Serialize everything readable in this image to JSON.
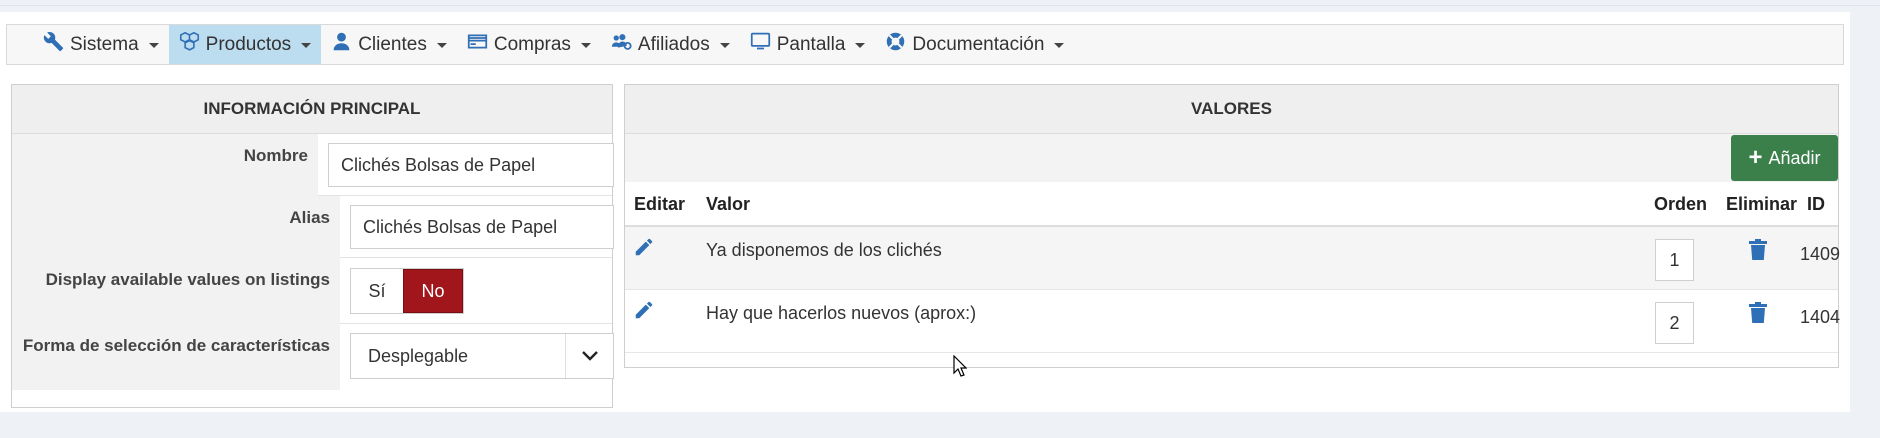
{
  "navbar": {
    "items": [
      {
        "label": "Sistema",
        "icon": "wrench-icon",
        "active": false
      },
      {
        "label": "Productos",
        "icon": "cubes-icon",
        "active": true
      },
      {
        "label": "Clientes",
        "icon": "user-icon",
        "active": false
      },
      {
        "label": "Compras",
        "icon": "credit-card-icon",
        "active": false
      },
      {
        "label": "Afiliados",
        "icon": "users-cog-icon",
        "active": false
      },
      {
        "label": "Pantalla",
        "icon": "monitor-icon",
        "active": false
      },
      {
        "label": "Documentación",
        "icon": "life-ring-icon",
        "active": false
      }
    ]
  },
  "info": {
    "heading": "INFORMACIÓN PRINCIPAL",
    "nombre_label": "Nombre",
    "nombre_value": "Clichés Bolsas de Papel",
    "alias_label": "Alias",
    "alias_value": "Clichés Bolsas de Papel",
    "display_label": "Display available values on listings",
    "toggle_si": "Sí",
    "toggle_no": "No",
    "toggle_selected": "No",
    "forma_label": "Forma de selección de características",
    "forma_value": "Desplegable"
  },
  "valores": {
    "heading": "VALORES",
    "add_label": "Añadir",
    "columns": {
      "editar": "Editar",
      "valor": "Valor",
      "orden": "Orden",
      "eliminar": "Eliminar",
      "id": "ID"
    },
    "rows": [
      {
        "valor": "Ya disponemos de los clichés",
        "orden": "1",
        "id": "1409"
      },
      {
        "valor": "Hay que hacerlos nuevos (aprox:)",
        "orden": "2",
        "id": "1404"
      }
    ]
  },
  "colors": {
    "accent": "#2f6fb5",
    "danger": "#a1161b",
    "success": "#3b7f4b",
    "active_nav": "#bcdcf0"
  }
}
